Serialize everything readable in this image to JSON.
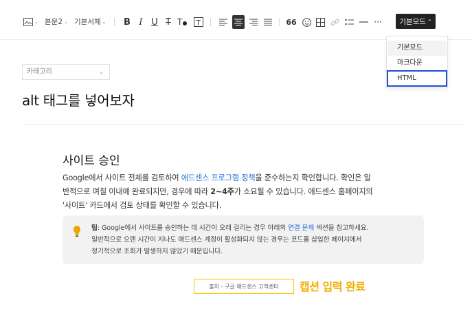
{
  "toolbar": {
    "paragraph_style": "본문2",
    "font_family": "기본서체",
    "quote_glyph": "66",
    "mode_button": "기본모드"
  },
  "mode_menu": {
    "items": [
      "기본모드",
      "마크다운",
      "HTML"
    ]
  },
  "editor": {
    "category_placeholder": "카테고리",
    "post_title": "alt 태그를 넣어보자"
  },
  "content": {
    "heading": "사이트 승인",
    "para_l1_a": "Google에서 사이트 전체를 검토하여 ",
    "para_l1_link": "애드센스 프로그램 정책",
    "para_l1_b": "을 준수하는지 확인합니다. 확인은 일",
    "para_l2_a": "반적으로 며칠 이내에 완료되지만, 경우에 따라 ",
    "para_l2_bold": "2~4주",
    "para_l2_b": "가 소요될 수 있습니다. 애드센스 홈페이지의",
    "para_l3": "'사이트' 카드에서 검토 상태를 확인할 수 있습니다.",
    "tip_label": "팁",
    "tip_l1_a": ": Google에서 사이트를 승인하는 데 시간이 오래 걸리는 경우 아래의 ",
    "tip_l1_link": "연결 문제",
    "tip_l1_b": " 섹션을 참고하세요.",
    "tip_l2": "일반적으로 오랜 시간이 지나도 애드센스 계정이 활성화되지 않는 경우는 코드를 삽입한 페이지에서",
    "tip_l3": "정기적으로 조회가 발생하지 않았기 때문입니다.",
    "caption": "출처 - 구글 애드센스 고객센터",
    "caption_note": "캡션 입력 완료"
  },
  "colors": {
    "link": "#2b6fd6",
    "highlight_outline": "#1f4fd6",
    "caption_accent": "#f0ae00",
    "bulb": "#f0a400"
  }
}
